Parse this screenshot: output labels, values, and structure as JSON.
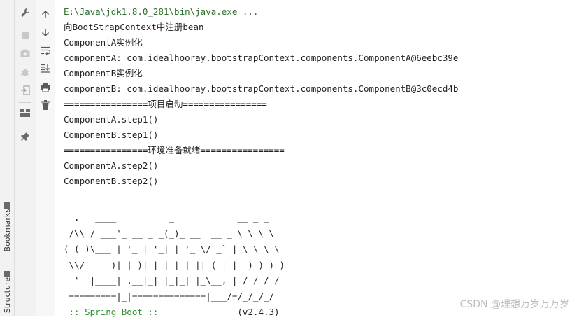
{
  "side_tabs": [
    {
      "label": "Bookmarks",
      "icon": "bookmark-icon"
    },
    {
      "label": "Structure",
      "icon": "structure-icon"
    }
  ],
  "toolbar_left": [
    "wrench-icon",
    "stop-icon",
    "camera-icon",
    "bug-icon",
    "exit-icon",
    "layout-icon",
    "pin-icon"
  ],
  "toolbar_right": [
    "arrow-up-icon",
    "arrow-down-icon",
    "soft-wrap-icon",
    "scroll-to-end-icon",
    "print-icon",
    "trash-icon"
  ],
  "console": {
    "command": "E:\\Java\\jdk1.8.0_281\\bin\\java.exe ...",
    "lines": [
      "向BootStrapContext中注册bean",
      "ComponentA实例化",
      "componentA: com.idealhooray.bootstrapContext.components.ComponentA@6eebc39e",
      "ComponentB实例化",
      "componentB: com.idealhooray.bootstrapContext.components.ComponentB@3c0ecd4b",
      "================项目启动================",
      "ComponentA.step1()",
      "ComponentB.step1()",
      "================环境准备就绪================",
      "ComponentA.step2()",
      "ComponentB.step2()"
    ],
    "banner": "  .   ____          _            __ _ _\n /\\\\ / ___'_ __ _ _(_)_ __  __ _ \\ \\ \\ \\\n( ( )\\___ | '_ | '_| | '_ \\/ _` | \\ \\ \\ \\\n \\\\/  ___)| |_)| | | | | || (_| |  ) ) ) )\n  '  |____| .__|_| |_|_| |_\\__, | / / / /\n =========|_|==============|___/=/_/_/_/",
    "boot_label": " :: Spring Boot :: ",
    "boot_version": "              (v2.4.3)"
  },
  "watermark": "CSDN @理想万岁万万岁"
}
